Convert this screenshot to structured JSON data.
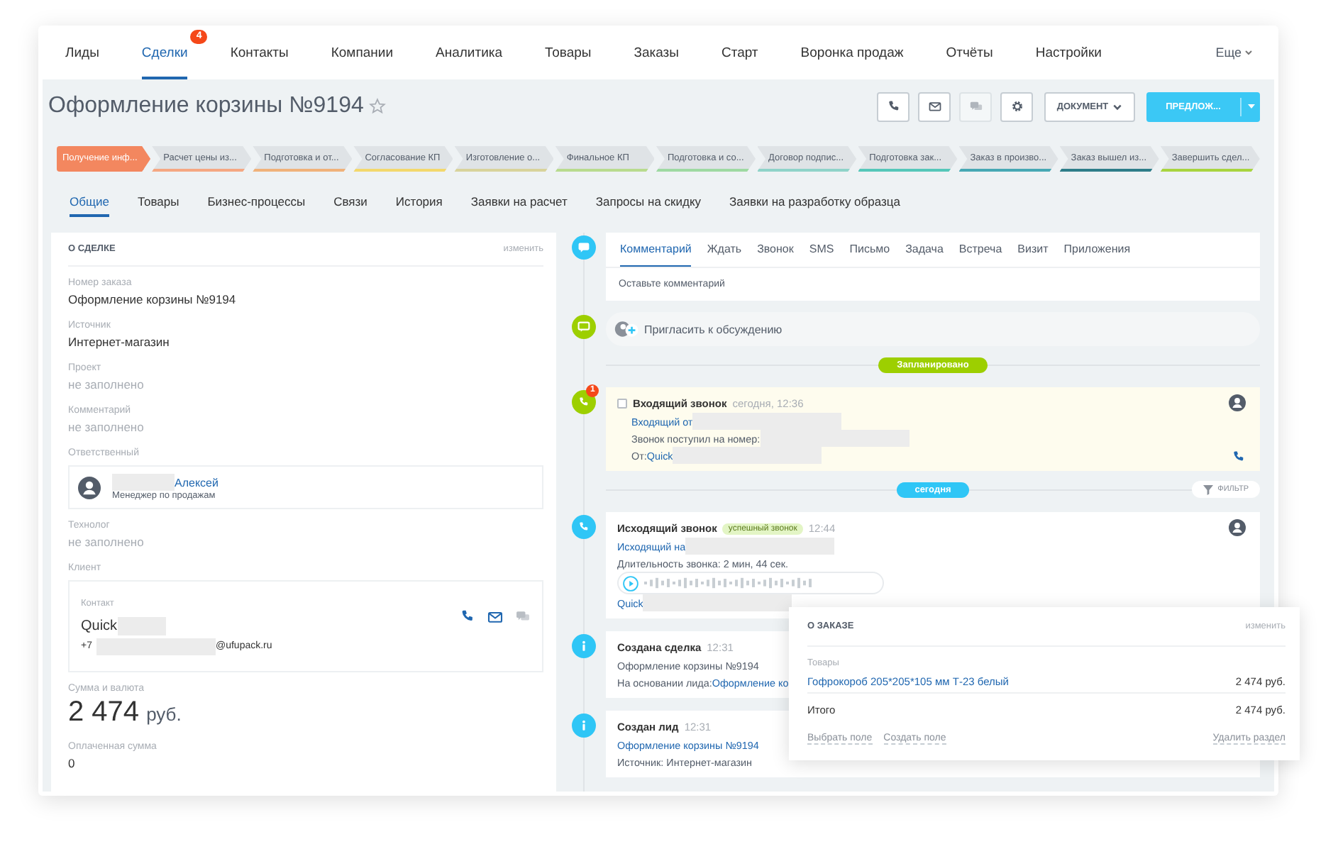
{
  "nav": {
    "items": [
      {
        "label": "Лиды",
        "selected": false
      },
      {
        "label": "Сделки",
        "selected": true,
        "badge": "4"
      },
      {
        "label": "Контакты",
        "selected": false
      },
      {
        "label": "Компании",
        "selected": false
      },
      {
        "label": "Аналитика",
        "selected": false
      },
      {
        "label": "Товары",
        "selected": false
      },
      {
        "label": "Заказы",
        "selected": false
      },
      {
        "label": "Старт",
        "selected": false
      },
      {
        "label": "Воронка продаж",
        "selected": false
      },
      {
        "label": "Отчёты",
        "selected": false
      },
      {
        "label": "Настройки",
        "selected": false
      }
    ],
    "more": "Еще"
  },
  "header": {
    "title": "Оформление корзины №9194",
    "starred": false,
    "icon_buttons": [
      {
        "kind": "phone",
        "disabled": false
      },
      {
        "kind": "mail",
        "disabled": false
      },
      {
        "kind": "chat",
        "disabled": true
      },
      {
        "kind": "settings",
        "disabled": false
      }
    ],
    "document_button": "ДОКУМЕНТ",
    "primary_button": "ПРЕДЛОЖ..."
  },
  "stages": [
    {
      "label": "Получение инф...",
      "selected": true,
      "color": "#f3875f"
    },
    {
      "label": "Расчет цены из...",
      "selected": false,
      "color": "#f5a782"
    },
    {
      "label": "Подготовка и от...",
      "selected": false,
      "color": "#f0b27a"
    },
    {
      "label": "Согласование КП",
      "selected": false,
      "color": "#f3d86c"
    },
    {
      "label": "Изготовление о...",
      "selected": false,
      "color": "#d8d39b"
    },
    {
      "label": "Финальное КП",
      "selected": false,
      "color": "#b8db8e"
    },
    {
      "label": "Подготовка и со...",
      "selected": false,
      "color": "#9ed9a2"
    },
    {
      "label": "Договор подпис...",
      "selected": false,
      "color": "#8fd3c9"
    },
    {
      "label": "Подготовка зак...",
      "selected": false,
      "color": "#55c7b9"
    },
    {
      "label": "Заказ в произво...",
      "selected": false,
      "color": "#47a8b4"
    },
    {
      "label": "Заказ вышел из...",
      "selected": false,
      "color": "#2e7d89"
    },
    {
      "label": "Завершить сдел...",
      "selected": false,
      "color": "#a8d43f"
    }
  ],
  "tabs": [
    {
      "label": "Общие",
      "selected": true
    },
    {
      "label": "Товары",
      "selected": false
    },
    {
      "label": "Бизнес-процессы",
      "selected": false
    },
    {
      "label": "Связи",
      "selected": false
    },
    {
      "label": "История",
      "selected": false
    },
    {
      "label": "Заявки на расчет",
      "selected": false
    },
    {
      "label": "Запросы на скидку",
      "selected": false
    },
    {
      "label": "Заявки на разработку образца",
      "selected": false
    }
  ],
  "deal_panel": {
    "title": "О СДЕЛКЕ",
    "edit": "изменить",
    "fields": [
      {
        "kind": "text",
        "label": "Номер заказа",
        "value": "Оформление корзины №9194"
      },
      {
        "kind": "text",
        "label": "Источник",
        "value": "Интернет-магазин"
      },
      {
        "kind": "empty",
        "label": "Проект",
        "value": "не заполнено"
      },
      {
        "kind": "empty",
        "label": "Комментарий",
        "value": "не заполнено"
      },
      {
        "kind": "person",
        "label": "Ответственный",
        "name": "Алексей",
        "role": "Менеджер по продажам"
      },
      {
        "kind": "empty",
        "label": "Технолог",
        "value": "не заполнено"
      },
      {
        "kind": "client",
        "label": "Клиент",
        "contact_label": "Контакт",
        "name": "Quick",
        "phone": "+7",
        "email": "@ufupack.ru"
      },
      {
        "kind": "amount",
        "label": "Сумма и валюта",
        "value": "2 474",
        "currency": "руб."
      },
      {
        "kind": "text",
        "label": "Оплаченная сумма",
        "value": "0"
      }
    ]
  },
  "composer": {
    "tabs": [
      {
        "label": "Комментарий",
        "selected": true
      },
      {
        "label": "Ждать",
        "selected": false
      },
      {
        "label": "Звонок",
        "selected": false
      },
      {
        "label": "SMS",
        "selected": false
      },
      {
        "label": "Письмо",
        "selected": false
      },
      {
        "label": "Задача",
        "selected": false
      },
      {
        "label": "Встреча",
        "selected": false
      },
      {
        "label": "Визит",
        "selected": false
      },
      {
        "label": "Приложения",
        "selected": false
      }
    ],
    "placeholder": "Оставьте комментарий"
  },
  "invite": "Пригласить к обсуждению",
  "timeline": [
    {
      "kind": "section",
      "label": "Запланировано",
      "color": "#9dcf00"
    },
    {
      "kind": "call",
      "color": "#9dcf00",
      "highlighted": true,
      "badge": "1",
      "checked": false,
      "title": "Входящий звонок",
      "time": "сегодня, 12:36",
      "callback_icon": true,
      "lines": [
        {
          "kind": "text",
          "parts": [
            {
              "text": "Входящий от",
              "link": true
            }
          ],
          "redacted": true
        },
        {
          "kind": "text",
          "parts": [
            {
              "text": "Звонок поступил на номер:",
              "link": false
            }
          ],
          "redacted": true
        },
        {
          "kind": "text",
          "parts": [
            {
              "text": "От: ",
              "link": false
            },
            {
              "text": "Quick",
              "link": true
            }
          ],
          "redacted": true
        }
      ]
    },
    {
      "kind": "section",
      "label": "сегодня",
      "color": "#2fc6f6",
      "filter": "ФИЛЬТР"
    },
    {
      "kind": "call",
      "color": "#2fc6f6",
      "highlighted": false,
      "title": "Исходящий звонок",
      "tag": "успешный звонок",
      "time": "12:44",
      "callback_icon": false,
      "lines": [
        {
          "kind": "text",
          "parts": [
            {
              "text": "Исходящий на",
              "link": true
            }
          ],
          "redacted": true
        },
        {
          "kind": "text",
          "parts": [
            {
              "text": "Длительность звонка: 2 мин, 44 сек.",
              "link": false
            }
          ],
          "redacted": false
        },
        {
          "kind": "audio"
        },
        {
          "kind": "text",
          "parts": [
            {
              "text": "Quick",
              "link": true
            }
          ],
          "redacted": true
        }
      ]
    },
    {
      "kind": "info",
      "color": "#2fc6f6",
      "title": "Создана сделка",
      "time": "12:31",
      "lines": [
        {
          "kind": "text",
          "parts": [
            {
              "text": "Оформление корзины №9194",
              "link": false
            }
          ],
          "redacted": false
        },
        {
          "kind": "text",
          "parts": [
            {
              "text": "На основании лида: ",
              "link": false
            },
            {
              "text": "Оформление ко",
              "link": true
            }
          ],
          "redacted": false
        }
      ]
    },
    {
      "kind": "info",
      "color": "#2fc6f6",
      "title": "Создан лид",
      "time": "12:31",
      "lines": [
        {
          "kind": "text",
          "parts": [
            {
              "text": "Оформление корзины №9194",
              "link": true
            }
          ],
          "redacted": false
        },
        {
          "kind": "text",
          "parts": [
            {
              "text": "Источник: Интернет-магазин",
              "link": false
            }
          ],
          "redacted": false
        }
      ]
    }
  ],
  "order_popup": {
    "title": "О ЗАКАЗЕ",
    "edit": "изменить",
    "products_label": "Товары",
    "products": [
      {
        "name": "Гофрокороб 205*205*105 мм Т-23 белый",
        "price": "2 474 руб."
      }
    ],
    "total_label": "Итого",
    "total": "2 474 руб.",
    "footer": [
      "Выбрать поле",
      "Создать поле"
    ],
    "remove": "Удалить раздел"
  }
}
